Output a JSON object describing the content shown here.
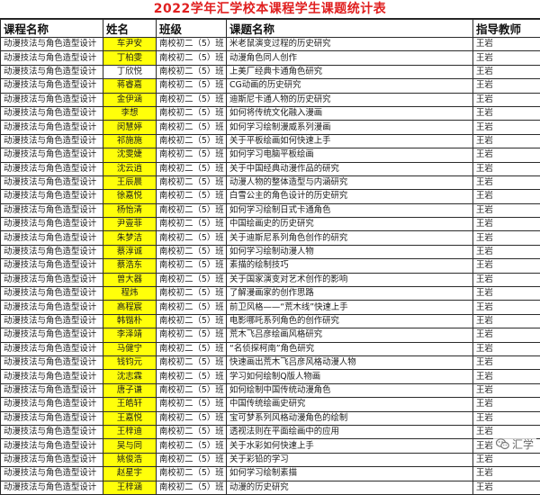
{
  "sheet": {
    "title": "2022学年汇学校本课程学生课题统计表",
    "headers": {
      "course": "课程名称",
      "name": "姓名",
      "class": "班级",
      "topic": "课题名称",
      "teacher": "指导教师"
    },
    "rows": [
      {
        "course": "动漫技法与角色造型设计",
        "name": "车尹安",
        "class": "南校初二（5）班",
        "topic": "米老鼠演变过程的历史研究",
        "teacher": "王岩",
        "highlight": true
      },
      {
        "course": "动漫技法与角色造型设计",
        "name": "丁柏雯",
        "class": "南校初二（5）班",
        "topic": "动漫角色同人创作",
        "teacher": "王岩",
        "highlight": true
      },
      {
        "course": "动漫技法与角色造型设计",
        "name": "丁欣悦",
        "class": "南校初二（5）班",
        "topic": "上美厂经典卡通角色研究",
        "teacher": "王岩",
        "highlight": false
      },
      {
        "course": "动漫技法与角色造型设计",
        "name": "蒋睿嘉",
        "class": "南校初二（5）班",
        "topic": "CG动画的历史研究",
        "teacher": "王岩",
        "highlight": true
      },
      {
        "course": "动漫技法与角色造型设计",
        "name": "金伊涵",
        "class": "南校初二（5）班",
        "topic": "迪斯尼卡通人物的历史研究",
        "teacher": "王岩",
        "highlight": true
      },
      {
        "course": "动漫技法与角色造型设计",
        "name": "李想",
        "class": "南校初二（5）班",
        "topic": "如何将传统文化融入漫画",
        "teacher": "王岩",
        "highlight": true
      },
      {
        "course": "动漫技法与角色造型设计",
        "name": "闵慧婷",
        "class": "南校初二（5）班",
        "topic": "如何学习绘制漫威系列漫画",
        "teacher": "王岩",
        "highlight": true
      },
      {
        "course": "动漫技法与角色造型设计",
        "name": "祁施施",
        "class": "南校初二（5）班",
        "topic": "关于平板绘画如何快速上手",
        "teacher": "王岩",
        "highlight": true
      },
      {
        "course": "动漫技法与角色造型设计",
        "name": "沈雯婕",
        "class": "南校初二（5）班",
        "topic": "如何学习电脑平板绘画",
        "teacher": "王岩",
        "highlight": true
      },
      {
        "course": "动漫技法与角色造型设计",
        "name": "沈云逍",
        "class": "南校初二（5）班",
        "topic": "关于中国经典动漫作品的研究",
        "teacher": "王岩",
        "highlight": true
      },
      {
        "course": "动漫技法与角色造型设计",
        "name": "王辰晨",
        "class": "南校初二（5）班",
        "topic": "动漫人物的整体造型与内涵研究",
        "teacher": "王岩",
        "highlight": true
      },
      {
        "course": "动漫技法与角色造型设计",
        "name": "徐嘉悦",
        "class": "南校初二（5）班",
        "topic": "白雪公主的角色设计的历史研究",
        "teacher": "王岩",
        "highlight": true
      },
      {
        "course": "动漫技法与角色造型设计",
        "name": "杨怡清",
        "class": "南校初二（5）班",
        "topic": "如何学习绘制日式卡通角色",
        "teacher": "王岩",
        "highlight": true
      },
      {
        "course": "动漫技法与角色造型设计",
        "name": "尹壹菲",
        "class": "南校初二（5）班",
        "topic": "中国绘画史的历史研究",
        "teacher": "王岩",
        "highlight": true
      },
      {
        "course": "动漫技法与角色造型设计",
        "name": "朱梦洁",
        "class": "南校初二（5）班",
        "topic": "关于迪斯尼系列角色创作的研究",
        "teacher": "王岩",
        "highlight": true
      },
      {
        "course": "动漫技法与角色造型设计",
        "name": "蔡淳诚",
        "class": "南校初二（5）班",
        "topic": "如何学习绘制动漫人物",
        "teacher": "王岩",
        "highlight": true
      },
      {
        "course": "动漫技法与角色造型设计",
        "name": "蔡浩东",
        "class": "南校初二（5）班",
        "topic": "素描的绘制技巧",
        "teacher": "王岩",
        "highlight": true
      },
      {
        "course": "动漫技法与角色造型设计",
        "name": "曾大器",
        "class": "南校初二（5）班",
        "topic": "关于国家演变对艺术创作的影响",
        "teacher": "王岩",
        "highlight": true
      },
      {
        "course": "动漫技法与角色造型设计",
        "name": "程炜",
        "class": "南校初二（5）班",
        "topic": "了解漫画家的创作思路",
        "teacher": "王岩",
        "highlight": true
      },
      {
        "course": "动漫技法与角色造型设计",
        "name": "高程宸",
        "class": "南校初二（5）班",
        "topic": "前卫风格——“荒木线”快速上手",
        "teacher": "王岩",
        "highlight": true
      },
      {
        "course": "动漫技法与角色造型设计",
        "name": "韩锴朴",
        "class": "南校初二（5）班",
        "topic": "电影哪吒系列角色的创作研究",
        "teacher": "王岩",
        "highlight": true
      },
      {
        "course": "动漫技法与角色造型设计",
        "name": "李泽靖",
        "class": "南校初二（5）班",
        "topic": "荒木飞吕彦绘画风格研究",
        "teacher": "王岩",
        "highlight": true
      },
      {
        "course": "动漫技法与角色造型设计",
        "name": "马健宁",
        "class": "南校初二（5）班",
        "topic": "“名侦探柯南”角色研究",
        "teacher": "王岩",
        "highlight": true
      },
      {
        "course": "动漫技法与角色造型设计",
        "name": "钱钧元",
        "class": "南校初二（5）班",
        "topic": "快速画出荒木飞吕彦风格动漫人物",
        "teacher": "王岩",
        "highlight": true
      },
      {
        "course": "动漫技法与角色造型设计",
        "name": "沈志霖",
        "class": "南校初二（5）班",
        "topic": "学习如何绘制Q版人物画",
        "teacher": "王岩",
        "highlight": true
      },
      {
        "course": "动漫技法与角色造型设计",
        "name": "唐子谦",
        "class": "南校初二（5）班",
        "topic": "如何绘制中国传统动漫角色",
        "teacher": "王岩",
        "highlight": true
      },
      {
        "course": "动漫技法与角色造型设计",
        "name": "王皓轩",
        "class": "南校初二（5）班",
        "topic": "中国传统绘画史研究",
        "teacher": "王岩",
        "highlight": true
      },
      {
        "course": "动漫技法与角色造型设计",
        "name": "王嘉悦",
        "class": "南校初二（5）班",
        "topic": "宝可梦系列风格动漫角色的绘制",
        "teacher": "王岩",
        "highlight": true
      },
      {
        "course": "动漫技法与角色造型设计",
        "name": "王梓迪",
        "class": "南校初二（5）班",
        "topic": "透视法则在平面绘画中的应用",
        "teacher": "王岩",
        "highlight": true
      },
      {
        "course": "动漫技法与角色造型设计",
        "name": "吴与同",
        "class": "南校初二（5）班",
        "topic": "关于水彩如何快速上手",
        "teacher": "王岩",
        "highlight": true
      },
      {
        "course": "动漫技法与角色造型设计",
        "name": "姚俊浩",
        "class": "南校初二（5）班",
        "topic": "关于彩铅的学习",
        "teacher": "王岩",
        "highlight": true
      },
      {
        "course": "动漫技法与角色造型设计",
        "name": "赵星宇",
        "class": "南校初二（5）班",
        "topic": "如何学习绘制素描",
        "teacher": "王岩",
        "highlight": true
      },
      {
        "course": "动漫技法与角色造型设计",
        "name": "王梓涵",
        "class": "南校初二（5）班",
        "topic": "动漫的历史研究",
        "teacher": "王岩",
        "highlight": true
      }
    ]
  },
  "watermark": {
    "icon": "wechat-icon",
    "text": "汇学"
  }
}
